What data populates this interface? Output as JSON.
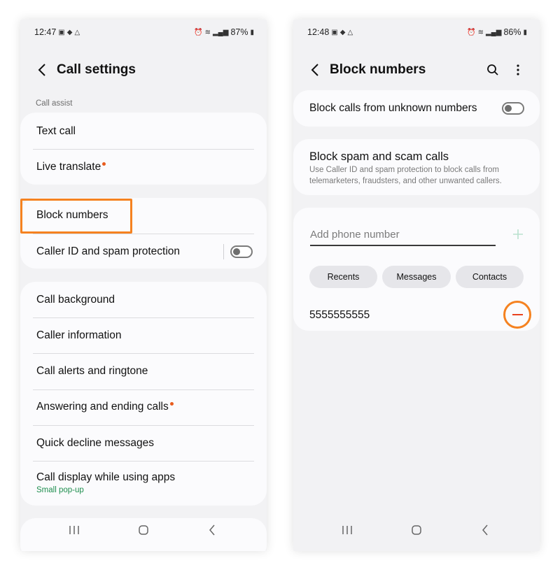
{
  "left_phone": {
    "status": {
      "time": "12:47",
      "battery": "87%"
    },
    "title": "Call settings",
    "section_call_assist": "Call assist",
    "group1": [
      {
        "label": "Text call"
      },
      {
        "label": "Live translate"
      }
    ],
    "group2": [
      {
        "label": "Block numbers"
      },
      {
        "label": "Caller ID and spam protection"
      }
    ],
    "group3": [
      {
        "label": "Call background"
      },
      {
        "label": "Caller information"
      },
      {
        "label": "Call alerts and ringtone"
      },
      {
        "label": "Answering and ending calls"
      },
      {
        "label": "Quick decline messages"
      },
      {
        "label": "Call display while using apps",
        "sub": "Small pop-up"
      }
    ]
  },
  "right_phone": {
    "status": {
      "time": "12:48",
      "battery": "86%"
    },
    "title": "Block numbers",
    "block_unknown": "Block calls from unknown numbers",
    "spam_title": "Block spam and scam calls",
    "spam_desc": "Use Caller ID and spam protection to block calls from telemarketers, fraudsters, and other unwanted callers.",
    "add_placeholder": "Add phone number",
    "pills": [
      "Recents",
      "Messages",
      "Contacts"
    ],
    "blocked_number": "5555555555"
  },
  "colors": {
    "highlight": "#f58220",
    "notification_dot": "#e85c1e",
    "sub_green": "#1e8e4e",
    "add_plus": "#b9e2cf"
  }
}
